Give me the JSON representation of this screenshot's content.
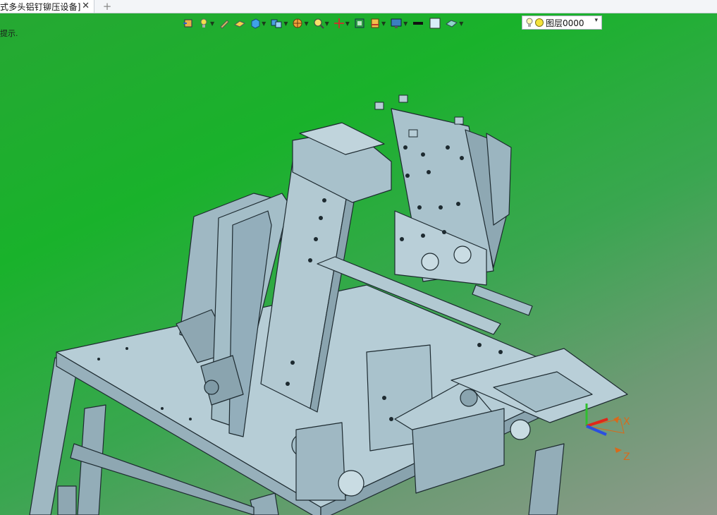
{
  "tab": {
    "title": "式多头铝钉铆压设备]",
    "close": "✕",
    "add": "+"
  },
  "viewport": {
    "hint": "提示."
  },
  "toolbar": {
    "layer_label": "图层0000",
    "layer_arrow": "▾"
  },
  "triad": {
    "x_label": "X",
    "z_label": "Z"
  },
  "colors": {
    "bg_top": "#19b22b",
    "bg_bottom": "#8f9a8c",
    "model_fill": "#a9c2cc",
    "model_stroke": "#1d2a30",
    "axis_x": "#e0271a",
    "axis_y": "#2fbf2f",
    "axis_z": "#2b4fe0"
  }
}
